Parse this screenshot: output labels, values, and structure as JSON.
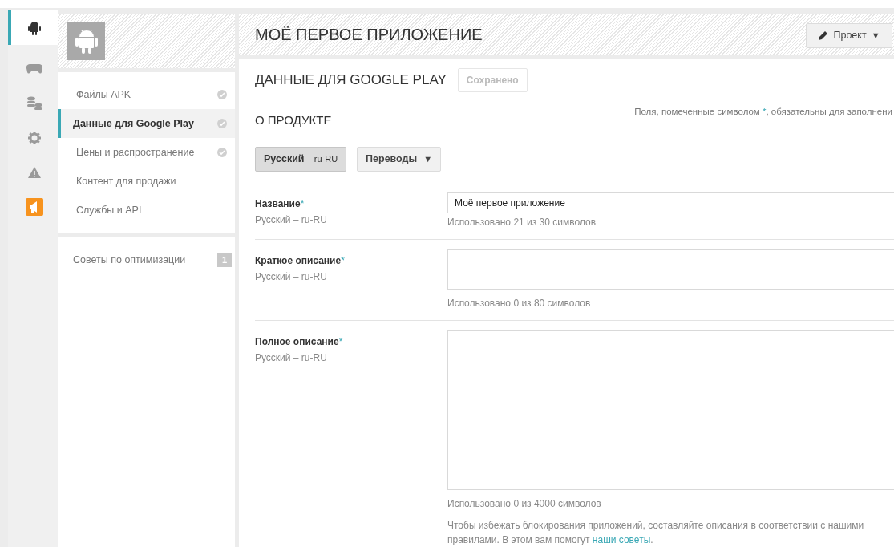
{
  "rail": [
    {
      "selected": true
    },
    {
      "selected": false
    },
    {
      "selected": false
    },
    {
      "selected": false
    },
    {
      "selected": false
    },
    {
      "selected": false
    }
  ],
  "sidebar": {
    "items": [
      {
        "label": "Файлы APK",
        "selected": false,
        "done": true
      },
      {
        "label": "Данные для Google Play",
        "selected": true,
        "done": true
      },
      {
        "label": "Цены и распространение",
        "selected": false,
        "done": true
      },
      {
        "label": "Контент для продажи",
        "selected": false,
        "done": false
      },
      {
        "label": "Службы и API",
        "selected": false,
        "done": false
      }
    ],
    "tips": {
      "label": "Советы по оптимизации",
      "badge": "1"
    }
  },
  "header": {
    "title": "МОЁ ПЕРВОЕ ПРИЛОЖЕНИЕ",
    "button": "Проект",
    "caret": "▼"
  },
  "section": {
    "title": "ДАННЫЕ ДЛЯ GOOGLE PLAY",
    "status": "Сохранено"
  },
  "product": {
    "title": "О ПРОДУКТЕ",
    "hint": [
      "Поля, помеченные символом ",
      "*",
      ", обязательны для заполнени"
    ]
  },
  "languages": {
    "current": "Русский",
    "current_code": "– ru-RU",
    "translations": "Переводы",
    "caret": "▼"
  },
  "fields": [
    {
      "kind": "input",
      "label": "Название",
      "mark": "*",
      "locale": "Русский – ru-RU",
      "value": "Моё первое приложение",
      "counter": "Использовано 21 из 30 символов"
    },
    {
      "kind": "short",
      "label": "Краткое описание",
      "mark": "*",
      "locale": "Русский – ru-RU",
      "counter": "Использовано 0 из 80 символов"
    },
    {
      "kind": "long",
      "label": "Полное описание",
      "mark": "*",
      "locale": "Русский – ru-RU",
      "counter": "Использовано 0 из 4000 символов"
    }
  ],
  "notice": {
    "text": "Чтобы избежать блокирования приложений, составляйте описания в соответствии с нашими правилами. В этом вам помогут ",
    "link": "наши советы",
    "end": "."
  }
}
